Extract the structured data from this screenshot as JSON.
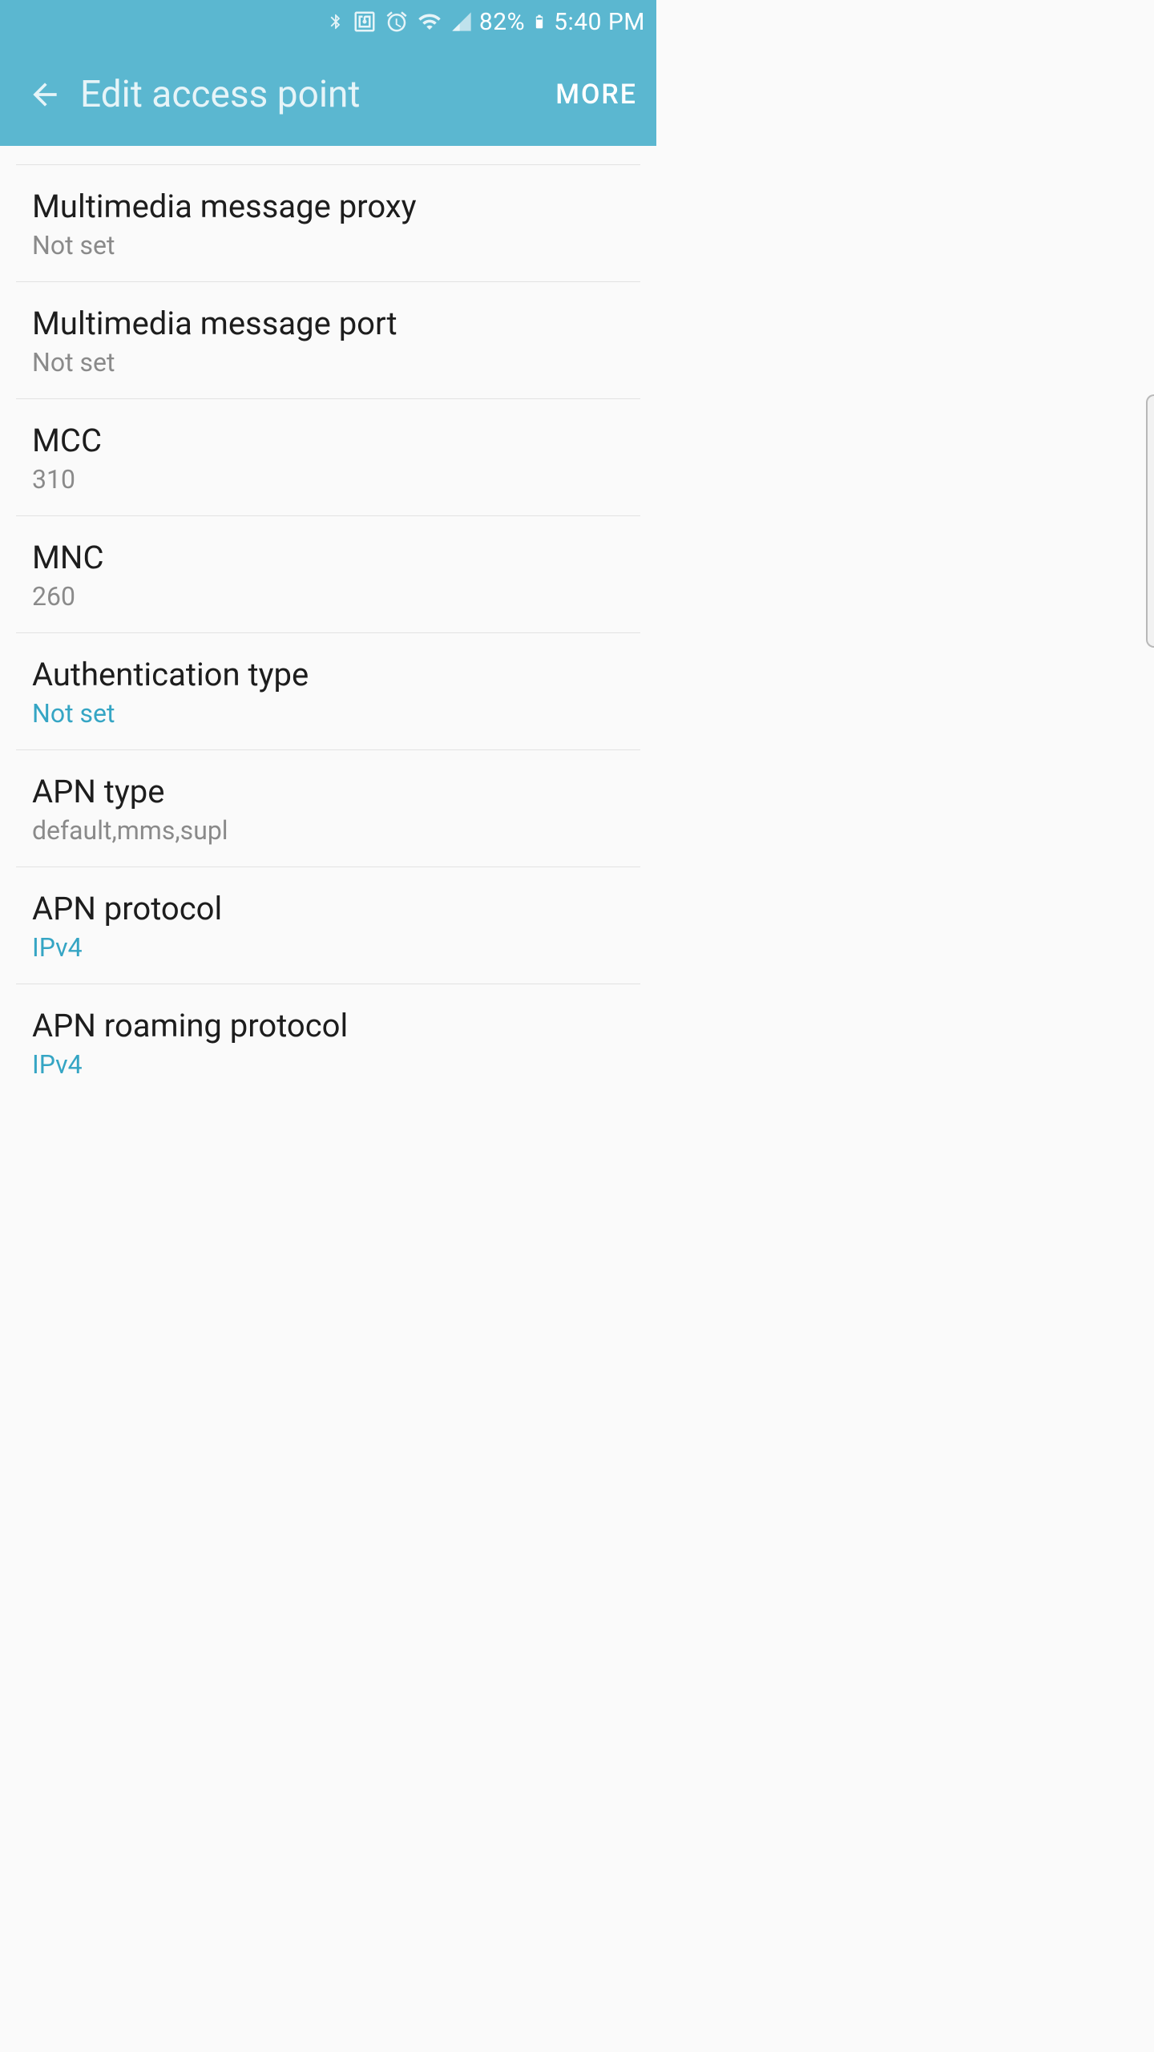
{
  "status": {
    "battery_pct": "82%",
    "time": "5:40 PM",
    "icons": [
      "bluetooth-icon",
      "nfc-icon",
      "alarm-icon",
      "wifi-icon",
      "signal-icon",
      "battery-icon"
    ]
  },
  "header": {
    "title": "Edit access point",
    "more_label": "MORE"
  },
  "rows": [
    {
      "title": "Multimedia message proxy",
      "value": "Not set",
      "accent": false
    },
    {
      "title": "Multimedia message port",
      "value": "Not set",
      "accent": false
    },
    {
      "title": "MCC",
      "value": "310",
      "accent": false
    },
    {
      "title": "MNC",
      "value": "260",
      "accent": false
    },
    {
      "title": "Authentication type",
      "value": "Not set",
      "accent": true
    },
    {
      "title": "APN type",
      "value": "default,mms,supl",
      "accent": false
    },
    {
      "title": "APN protocol",
      "value": "IPv4",
      "accent": true
    },
    {
      "title": "APN roaming protocol",
      "value": "IPv4",
      "accent": true
    }
  ]
}
